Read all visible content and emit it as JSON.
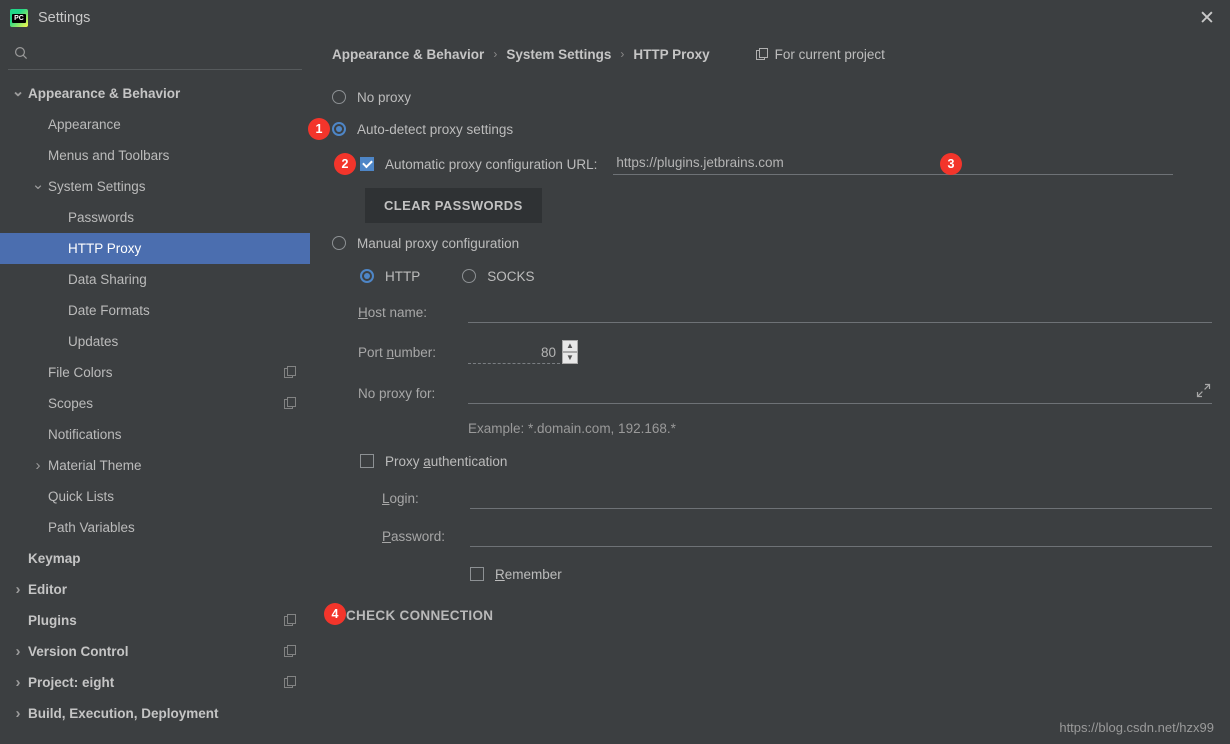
{
  "window": {
    "title": "Settings",
    "logo_icon": "pycharm-logo-icon",
    "logo_text": "PC",
    "close_icon": "close-icon"
  },
  "sidebar": {
    "search": {
      "value": "",
      "placeholder": "",
      "icon": "search-icon"
    },
    "items": [
      {
        "label": "Appearance & Behavior",
        "indent": 0,
        "twisty": "chevron-down",
        "bold": true,
        "selected": false,
        "copy": false
      },
      {
        "label": "Appearance",
        "indent": 1,
        "twisty": "none",
        "bold": false,
        "selected": false,
        "copy": false
      },
      {
        "label": "Menus and Toolbars",
        "indent": 1,
        "twisty": "none",
        "bold": false,
        "selected": false,
        "copy": false
      },
      {
        "label": "System Settings",
        "indent": 1,
        "twisty": "chevron-down",
        "bold": false,
        "selected": false,
        "copy": false
      },
      {
        "label": "Passwords",
        "indent": 2,
        "twisty": "none",
        "bold": false,
        "selected": false,
        "copy": false
      },
      {
        "label": "HTTP Proxy",
        "indent": 2,
        "twisty": "none",
        "bold": false,
        "selected": true,
        "copy": false
      },
      {
        "label": "Data Sharing",
        "indent": 2,
        "twisty": "none",
        "bold": false,
        "selected": false,
        "copy": false
      },
      {
        "label": "Date Formats",
        "indent": 2,
        "twisty": "none",
        "bold": false,
        "selected": false,
        "copy": false
      },
      {
        "label": "Updates",
        "indent": 2,
        "twisty": "none",
        "bold": false,
        "selected": false,
        "copy": false
      },
      {
        "label": "File Colors",
        "indent": 1,
        "twisty": "none",
        "bold": false,
        "selected": false,
        "copy": true
      },
      {
        "label": "Scopes",
        "indent": 1,
        "twisty": "none",
        "bold": false,
        "selected": false,
        "copy": true
      },
      {
        "label": "Notifications",
        "indent": 1,
        "twisty": "none",
        "bold": false,
        "selected": false,
        "copy": false
      },
      {
        "label": "Material Theme",
        "indent": 1,
        "twisty": "chevron-right",
        "bold": false,
        "selected": false,
        "copy": false
      },
      {
        "label": "Quick Lists",
        "indent": 1,
        "twisty": "none",
        "bold": false,
        "selected": false,
        "copy": false
      },
      {
        "label": "Path Variables",
        "indent": 1,
        "twisty": "none",
        "bold": false,
        "selected": false,
        "copy": false
      },
      {
        "label": "Keymap",
        "indent": 0,
        "twisty": "none",
        "bold": true,
        "selected": false,
        "copy": false
      },
      {
        "label": "Editor",
        "indent": 0,
        "twisty": "chevron-right",
        "bold": true,
        "selected": false,
        "copy": false
      },
      {
        "label": "Plugins",
        "indent": 0,
        "twisty": "none",
        "bold": true,
        "selected": false,
        "copy": true
      },
      {
        "label": "Version Control",
        "indent": 0,
        "twisty": "chevron-right",
        "bold": true,
        "selected": false,
        "copy": true
      },
      {
        "label": "Project: eight",
        "indent": 0,
        "twisty": "chevron-right",
        "bold": true,
        "selected": false,
        "copy": true
      },
      {
        "label": "Build, Execution, Deployment",
        "indent": 0,
        "twisty": "chevron-right",
        "bold": true,
        "selected": false,
        "copy": false
      }
    ]
  },
  "breadcrumb": {
    "crumb1": "Appearance & Behavior",
    "crumb2": "System Settings",
    "crumb3": "HTTP Proxy",
    "separator": "›",
    "for_current_project": "For current project",
    "for_current_project_icon": "copy-layers-icon"
  },
  "proxy": {
    "no_proxy_label": "No proxy",
    "no_proxy_selected": false,
    "auto_detect_label": "Auto-detect proxy settings",
    "auto_detect_selected": true,
    "auto_config_label": "Automatic proxy configuration URL:",
    "auto_config_checked": true,
    "auto_config_url": "https://plugins.jetbrains.com",
    "clear_passwords_label": "CLEAR PASSWORDS",
    "manual_label": "Manual proxy configuration",
    "manual_selected": false,
    "http_label": "HTTP",
    "http_selected": true,
    "socks_label": "SOCKS",
    "socks_selected": false,
    "host_label_pre": "H",
    "host_label_post": "ost name:",
    "host_value": "",
    "port_label_pre": "Port ",
    "port_label_mn": "n",
    "port_label_post": "umber:",
    "port_value": "80",
    "spin_up_icon": "chevron-up-icon",
    "spin_down_icon": "chevron-down-icon",
    "no_proxy_for_label": "No proxy for:",
    "no_proxy_for_value": "",
    "expand_icon": "expand-icon",
    "example_hint": "Example: *.domain.com, 192.168.*",
    "proxy_auth_pre": "Proxy ",
    "proxy_auth_mn": "a",
    "proxy_auth_post": "uthentication",
    "proxy_auth_checked": false,
    "login_label_pre": "L",
    "login_label_post": "ogin:",
    "login_value": "",
    "password_label_pre": "P",
    "password_label_post": "assword:",
    "password_value": "",
    "remember_pre": "R",
    "remember_post": "emember",
    "remember_checked": false,
    "check_connection_label": "CHECK CONNECTION"
  },
  "annotations": [
    {
      "num": "1"
    },
    {
      "num": "2"
    },
    {
      "num": "3"
    },
    {
      "num": "4"
    }
  ],
  "watermark": "https://blog.csdn.net/hzx99",
  "colors": {
    "background": "#3c3f41",
    "selection": "#4b6eaf",
    "accent": "#4e86c7",
    "badge": "#f3352b",
    "text": "#bbbbbb"
  }
}
